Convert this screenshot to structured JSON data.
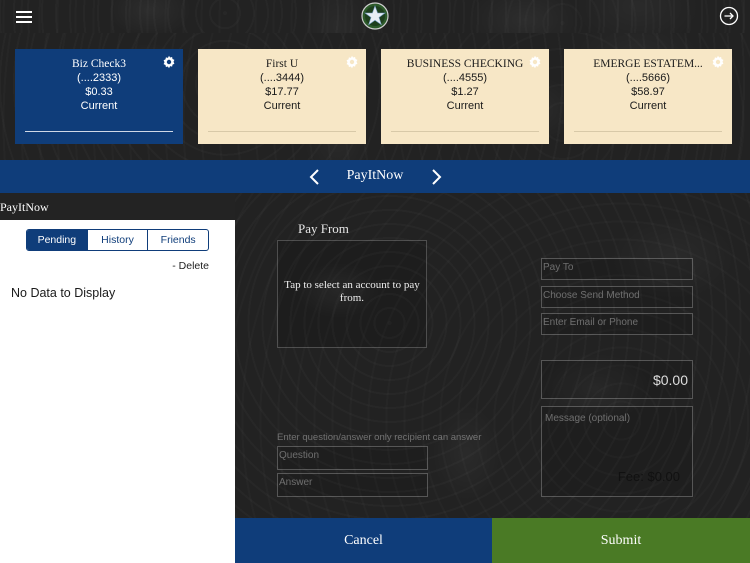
{
  "header": {
    "menu_icon": "hamburger-menu-icon",
    "logo_icon": "star-logo-icon",
    "logout_icon": "logout-icon"
  },
  "accounts": [
    {
      "name": "Biz Check3",
      "number": "(....2333)",
      "balance": "$0.33",
      "status": "Current",
      "selected": true
    },
    {
      "name": "First U",
      "number": "(....3444)",
      "balance": "$17.77",
      "status": "Current",
      "selected": false
    },
    {
      "name": "BUSINESS CHECKING",
      "number": "(....4555)",
      "balance": "$1.27",
      "status": "Current",
      "selected": false
    },
    {
      "name": "EMERGE ESTATEM...",
      "number": "(....5666)",
      "balance": "$58.97",
      "status": "Current",
      "selected": false
    }
  ],
  "titlebar": {
    "title": "PayItNow",
    "prev_icon": "chevron-left-icon",
    "next_icon": "chevron-right-icon"
  },
  "left_panel": {
    "heading": "PayItNow",
    "tabs": [
      "Pending",
      "History",
      "Friends"
    ],
    "active_tab": "Pending",
    "delete_label": "- Delete",
    "empty_message": "No Data to Display"
  },
  "form": {
    "pay_from_label": "Pay From",
    "pay_from_prompt": "Tap to select an account to pay from.",
    "pay_to_placeholder": "Pay To",
    "send_method_placeholder": "Choose Send Method",
    "email_phone_placeholder": "Enter Email or Phone",
    "amount": "$0.00",
    "message_placeholder": "Message (optional)",
    "fee": "Fee: $0.00",
    "question_instructions": "Enter question/answer only recipient can answer",
    "question_placeholder": "Question",
    "answer_placeholder": "Answer"
  },
  "actions": {
    "cancel_label": "Cancel",
    "submit_label": "Submit"
  },
  "colors": {
    "brand_blue": "#0f3d7a",
    "submit_green": "#4a7a25",
    "card_cream": "#f7e7c6"
  }
}
